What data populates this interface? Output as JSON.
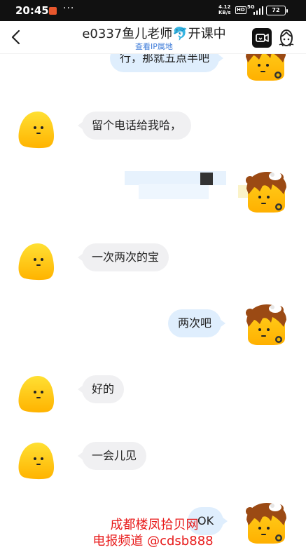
{
  "status_bar": {
    "time": "20:45",
    "dots": "···",
    "net_speed": "4.12",
    "net_unit": "KB/s",
    "hd": "HD",
    "network": "5G",
    "battery": "72"
  },
  "header": {
    "title": "e0337鱼儿老师🐬开课中",
    "subtitle": "查看IP属地"
  },
  "messages": [
    {
      "side": "out",
      "text": "行，那就五点半吧"
    },
    {
      "side": "in",
      "text": "留个电话给我哈，"
    },
    {
      "side": "out",
      "text": ""
    },
    {
      "side": "in",
      "text": "一次两次的宝"
    },
    {
      "side": "out",
      "text": "两次吧"
    },
    {
      "side": "in",
      "text": "好的"
    },
    {
      "side": "in",
      "text": "一会儿见"
    },
    {
      "side": "out",
      "text": "OK"
    }
  ],
  "watermark": {
    "line1": "成都楼凤拾贝网",
    "line2": "电报频道 @cdsb888"
  },
  "colors": {
    "incoming_bubble": "#f0f0f2",
    "outgoing_bubble": "#dfeefd",
    "link": "#3d7bd9",
    "watermark": "#e81b1b",
    "avatar_yellow": "#ffc20e"
  },
  "icons": {
    "back": "chevron-left-icon",
    "video": "video-call-icon",
    "profile": "profile-icon"
  }
}
